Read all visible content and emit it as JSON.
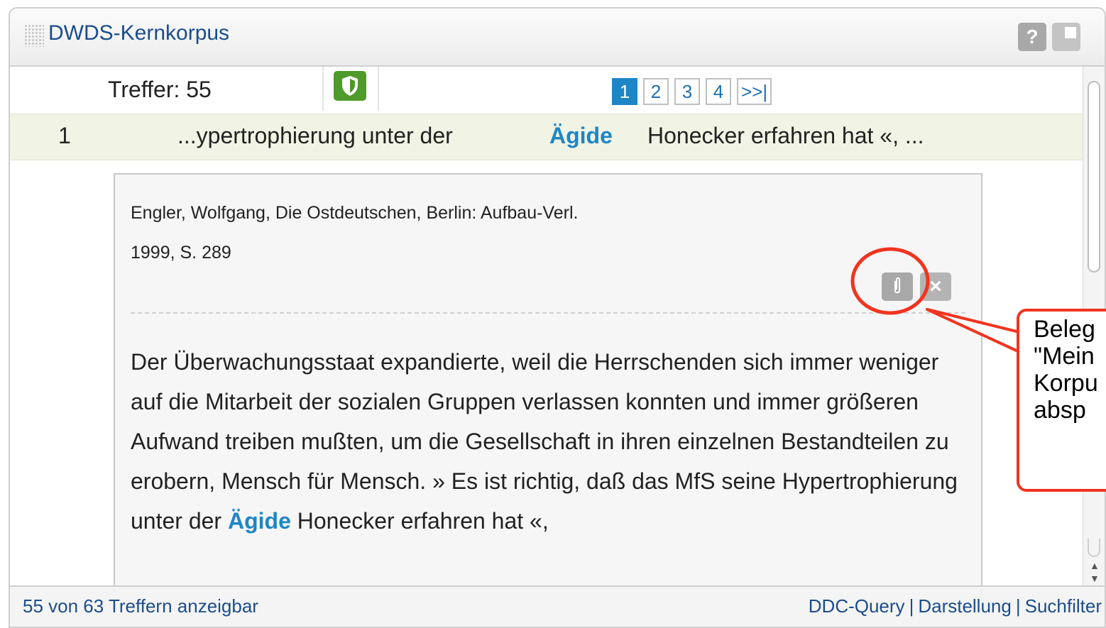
{
  "window": {
    "title": "DWDS-Kernkorpus",
    "help_label": "?"
  },
  "hits": {
    "label": "Treffer: 55",
    "pages": [
      "1",
      "2",
      "3",
      "4",
      ">>|"
    ],
    "active_page": "1"
  },
  "kwic": {
    "number": "1",
    "left": "...ypertrophierung unter der",
    "keyword": "Ägide",
    "right": "Honecker erfahren hat «, ..."
  },
  "detail": {
    "citation_line1": "Engler, Wolfgang, Die Ostdeutschen, Berlin: Aufbau-Verl.",
    "citation_line2": "1999, S. 289",
    "close_label": "×",
    "text_before": "Der Überwachungsstaat expandierte, weil die Herrschenden sich immer weniger auf die Mitarbeit der sozialen Gruppen verlassen konnten und immer größeren Aufwand treiben mußten, um die Gesellschaft in ihren einzelnen Bestandteilen zu erobern, Mensch für Mensch. » Es ist richtig, daß das MfS seine Hypertrophierung unter der",
    "keyword": "Ägide",
    "text_after": "Honecker erfahren hat «,"
  },
  "footer": {
    "status": "55 von 63 Treffern anzeigbar",
    "links": [
      "DDC-Query",
      "Darstellung",
      "Suchfilter"
    ],
    "separator": "|"
  },
  "callout": {
    "lines": [
      "Beleg",
      "\"Mein",
      "Korpu",
      "absp"
    ],
    "color": "#f0341f"
  },
  "colors": {
    "accent": "#1e86c6",
    "title": "#1a4d8c",
    "shield_green": "#4e9a2a",
    "kwic_row_bg": "#f1f3e4"
  }
}
